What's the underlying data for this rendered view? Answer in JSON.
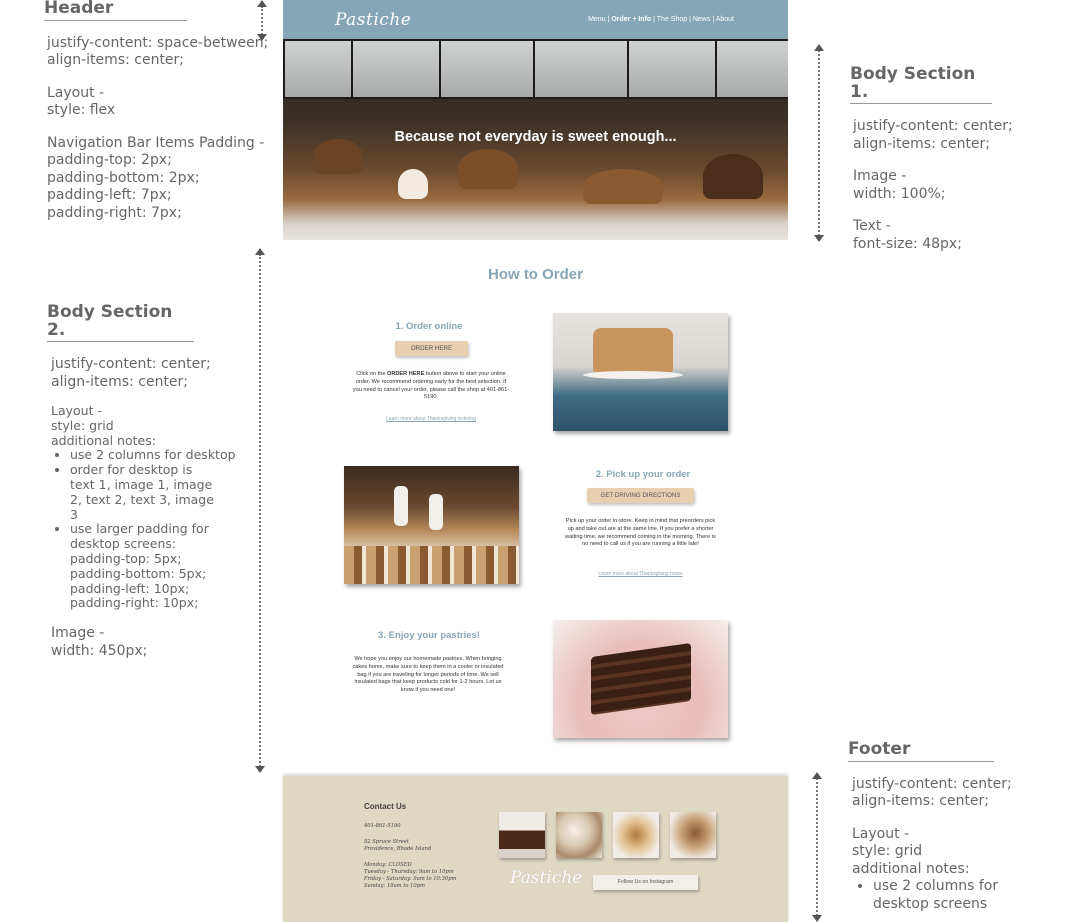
{
  "annotations": {
    "header": {
      "title": "Header",
      "lines": [
        "justify-content: space-between;",
        "align-items: center;"
      ],
      "layout": [
        "Layout -",
        "style: flex"
      ],
      "padding": [
        "Navigation Bar Items Padding -",
        "padding-top: 2px;",
        "padding-bottom: 2px;",
        "padding-left: 7px;",
        "padding-right: 7px;"
      ]
    },
    "body1": {
      "title": "Body Section 1.",
      "lines": [
        "justify-content: center;",
        "align-items: center;"
      ],
      "image": [
        "Image -",
        "width: 100%;"
      ],
      "text": [
        "Text -",
        "font-size: 48px;"
      ]
    },
    "body2": {
      "title": "Body Section 2.",
      "lines": [
        "justify-content: center;",
        "align-items: center;"
      ],
      "layout": [
        "Layout -",
        "style: grid",
        "additional notes:"
      ],
      "bullets": [
        "use 2 columns for desktop",
        "order for desktop is text 1, image 1, image 2, text 2, text 3, image 3",
        "use larger padding for desktop screens:"
      ],
      "padding": [
        "padding-top: 5px;",
        "padding-bottom: 5px;",
        "padding-left: 10px;",
        "padding-right: 10px;"
      ],
      "image": [
        "Image -",
        "width: 450px;"
      ]
    },
    "footer": {
      "title": "Footer",
      "lines": [
        "justify-content: center;",
        "align-items: center;"
      ],
      "layout": [
        "Layout -",
        "style: grid",
        "additional notes:"
      ],
      "bullets": [
        "use 2 columns for desktop screens"
      ]
    }
  },
  "mock": {
    "logo": "Pastiche",
    "nav": {
      "menu": "Menu",
      "order_info": "Order + Info",
      "shop": "The Shop",
      "news": "News",
      "about": "About",
      "sep": " | "
    },
    "hero_text": "Because not everyday is sweet enough...",
    "section_title": "How to Order",
    "steps": [
      {
        "title": "1. Order online",
        "button": "ORDER HERE",
        "text_before": "Click on the ",
        "text_bold": "ORDER HERE",
        "text_after": " button above to start your online order. We recommend ordering early for the best selection. If you need to cancel your order, please call the shop at 401-861-5190.",
        "link": "Learn more about Thanksgiving ordering"
      },
      {
        "title": "2. Pick up your order",
        "button": "GET DRIVING DIRECTIONS",
        "text": "Pick up your order in-store. Keep in mind that preorders pick up and take out are at the same line. If you prefer a shorter waiting time, we recommend coming in the morning. There is no need to call us if you are running a little late!",
        "link": "Learn more about Thanksgiving hours"
      },
      {
        "title": "3. Enjoy your pastries!",
        "text": "We hope you enjoy our homemade pastries. When bringing cakes home, make sure to keep them in a cooler or insulated bag if you are traveling for longer periods of time. We sell insulated bags that keep products cold for 1-2 hours. Let us know if you need one!"
      }
    ],
    "footer": {
      "title": "Contact Us",
      "phone": "401-861-5190",
      "address1": "92 Spruce Street",
      "address2": "Providence, Rhode Island",
      "hours": [
        "Monday: CLOSED",
        "Tuesday - Thursday: 9am to 10pm",
        "Friday - Saturday: 9am to 10:30pm",
        "Sunday: 10am to 10pm"
      ],
      "logo": "Pastiche",
      "instagram": "Follow Us on Instagram"
    }
  },
  "colors": {
    "header_blue": "#86a6b7",
    "button_tan": "#e8cfb0",
    "footer_beige": "#dfd8c3"
  }
}
